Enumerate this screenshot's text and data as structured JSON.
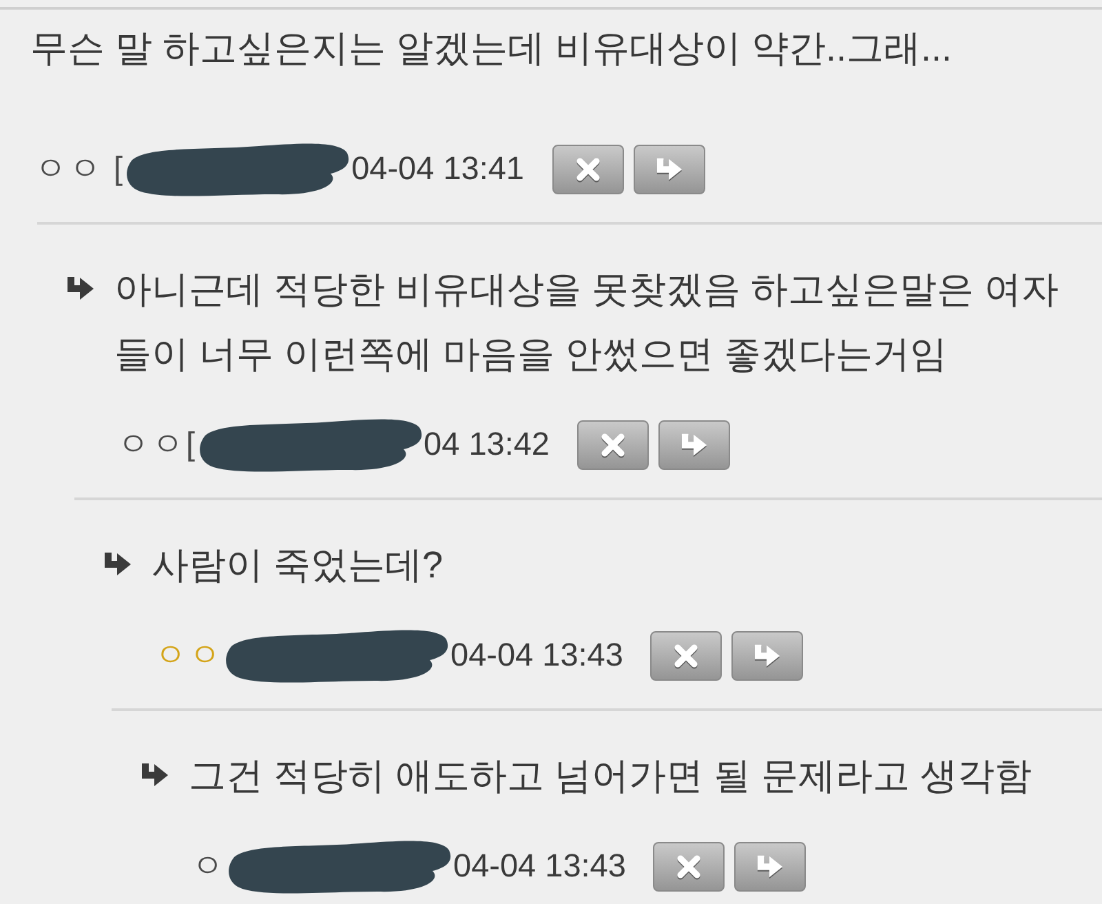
{
  "comments": [
    {
      "text": "무슨 말 하고싶은지는 알겠는데 비유대상이 약간..그래...",
      "author": {
        "nick": "ㅇㅇ [",
        "color": "#4a4a4a",
        "redacted": true
      },
      "time": "04-04 13:41",
      "children": [
        {
          "text": "아니근데 적당한 비유대상을 못찾겠음 하고싶은말은 여자들이 너무 이런쪽에 마음을 안썼으면 좋겠다는거임",
          "author": {
            "nick": "ㅇㅇ[",
            "color": "#4a4a4a",
            "redacted": true
          },
          "time": "04 13:42",
          "children": [
            {
              "text": "사람이 죽었는데?",
              "author": {
                "nick": "ㅇㅇ",
                "color": "#d4a418",
                "redacted": true
              },
              "time": "04-04 13:43",
              "children": [
                {
                  "text": "그건 적당히 애도하고 넘어가면 될 문제라고 생각함",
                  "author": {
                    "nick": "ㅇ",
                    "color": "#4a4a4a",
                    "redacted": true
                  },
                  "time": "04-04 13:43"
                }
              ]
            }
          ]
        }
      ]
    }
  ]
}
